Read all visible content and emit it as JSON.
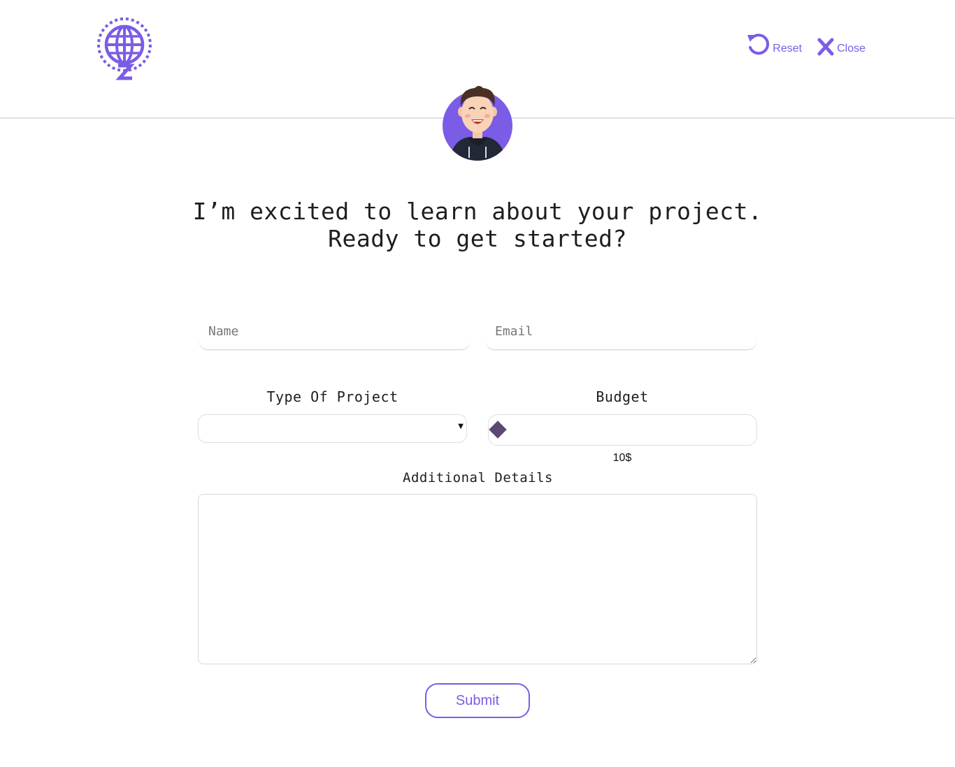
{
  "colors": {
    "accent": "#7b5ce6",
    "slider_thumb": "#5a4a72",
    "divider": "#e2e2e2",
    "avatar_bg": "#7b5ce6"
  },
  "header": {
    "logo_icon": "globe-z-logo",
    "reset_label": "Reset",
    "reset_icon": "rotate-ccw-icon",
    "close_label": "Close",
    "close_icon": "x-icon"
  },
  "avatar": {
    "icon": "smiling-man-avatar"
  },
  "headline": {
    "line1": "I’m excited to learn about your project.",
    "line2": "Ready to get started?"
  },
  "form": {
    "name_placeholder": "Name",
    "email_placeholder": "Email",
    "type_label": "Type Of Project",
    "type_selected": "",
    "budget_label": "Budget",
    "budget_value": "10$",
    "budget_fraction": 0,
    "details_label": "Additional Details",
    "details_value": "",
    "submit_label": "Submit"
  }
}
